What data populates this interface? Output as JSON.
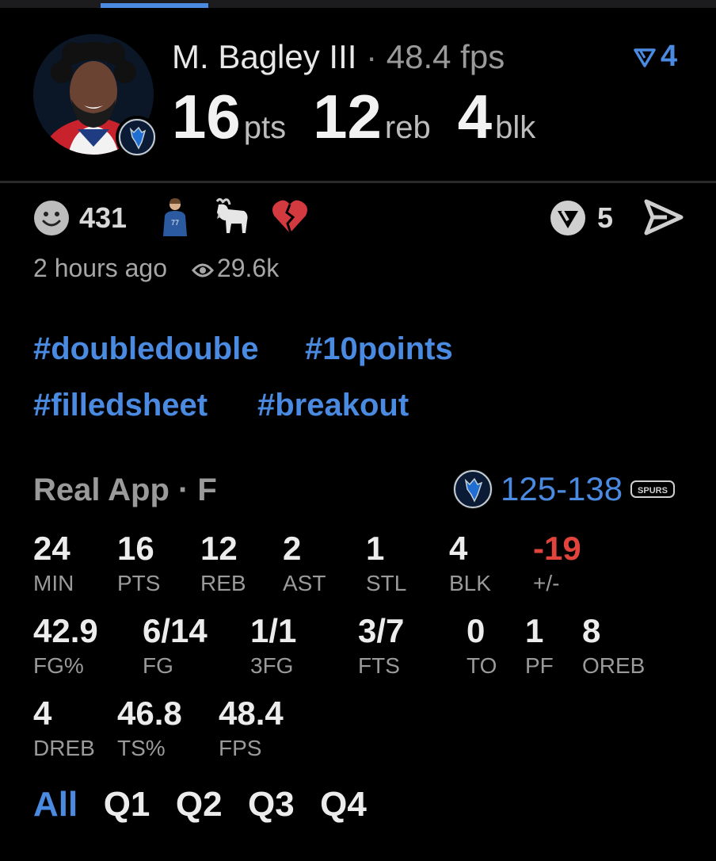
{
  "player": {
    "name": "M. Bagley III",
    "separator": "·",
    "fps": "48.4 fps",
    "rank": "4",
    "stats": [
      {
        "value": "16",
        "unit": "pts"
      },
      {
        "value": "12",
        "unit": "reb"
      },
      {
        "value": "4",
        "unit": "blk"
      }
    ]
  },
  "reactions": {
    "count": "431",
    "comments": "5"
  },
  "meta": {
    "time": "2 hours ago",
    "views": "29.6k"
  },
  "tags": [
    "#doubledouble",
    "#10points",
    "#filledsheet",
    "#breakout"
  ],
  "game": {
    "title": "Real App · F",
    "score": "125-138"
  },
  "box": [
    [
      {
        "v": "24",
        "l": "MIN"
      },
      {
        "v": "16",
        "l": "PTS"
      },
      {
        "v": "12",
        "l": "REB"
      },
      {
        "v": "2",
        "l": "AST"
      },
      {
        "v": "1",
        "l": "STL"
      },
      {
        "v": "4",
        "l": "BLK"
      },
      {
        "v": "-19",
        "l": "+/-"
      }
    ],
    [
      {
        "v": "42.9",
        "l": "FG%"
      },
      {
        "v": "6/14",
        "l": "FG"
      },
      {
        "v": "1/1",
        "l": "3FG"
      },
      {
        "v": "3/7",
        "l": "FTS"
      },
      {
        "v": "0",
        "l": "TO"
      },
      {
        "v": "1",
        "l": "PF"
      },
      {
        "v": "8",
        "l": "OREB"
      }
    ],
    [
      {
        "v": "4",
        "l": "DREB"
      },
      {
        "v": "46.8",
        "l": "TS%"
      },
      {
        "v": "48.4",
        "l": "FPS"
      }
    ]
  ],
  "quarters": [
    "All",
    "Q1",
    "Q2",
    "Q3",
    "Q4"
  ],
  "colors": {
    "accent": "#4a8ae0",
    "negative": "#e0443c",
    "background": "#000000"
  },
  "icons": [
    "smiley-icon",
    "player-emoji-icon",
    "goat-icon",
    "broken-heart-icon",
    "comment-icon",
    "share-icon",
    "eye-icon",
    "rank-arrow-icon",
    "mavericks-logo",
    "spurs-logo"
  ]
}
